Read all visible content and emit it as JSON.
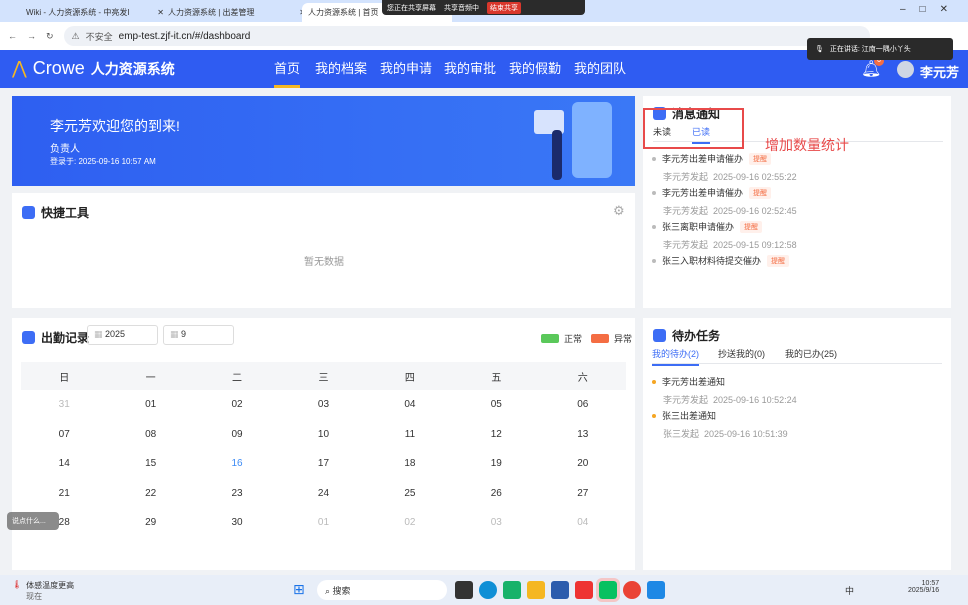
{
  "browser": {
    "tabs": [
      {
        "label": "Wiki - 人力资源系统 - 中亮发I"
      },
      {
        "label": "人力资源系统 | 出差管理"
      },
      {
        "label": "人力资源系统 | 首页"
      }
    ],
    "share_bar": {
      "sharing": "您正在共享屏幕",
      "audio": "共享音频中",
      "end": "结束共享"
    },
    "insecure": "不安全",
    "url": "emp-test.zjf-it.cn/#/dashboard",
    "speaking": "正在讲话: 江南一隅小丫头"
  },
  "header": {
    "brand": "Crowe",
    "system": "人力资源系统",
    "nav": [
      "首页",
      "我的档案",
      "我的申请",
      "我的审批",
      "我的假勤",
      "我的团队"
    ],
    "badge": "6",
    "user": "李元芳"
  },
  "banner": {
    "welcome": "李元芳欢迎您的到来!",
    "role": "负责人",
    "login": "登录于:  2025-09-16 10:57 AM"
  },
  "quick": {
    "title": "快捷工具",
    "empty": "暂无数据"
  },
  "attendance": {
    "title": "出勤记录",
    "year": "2025",
    "month": "9",
    "legend": [
      "正常",
      "异常"
    ],
    "weekdays": [
      "日",
      "一",
      "二",
      "三",
      "四",
      "五",
      "六"
    ],
    "weeks": [
      [
        "31",
        "01",
        "02",
        "03",
        "04",
        "05",
        "06"
      ],
      [
        "07",
        "08",
        "09",
        "10",
        "11",
        "12",
        "13"
      ],
      [
        "14",
        "15",
        "16",
        "17",
        "18",
        "19",
        "20"
      ],
      [
        "21",
        "22",
        "23",
        "24",
        "25",
        "26",
        "27"
      ],
      [
        "28",
        "29",
        "30",
        "01",
        "02",
        "03",
        "04"
      ]
    ]
  },
  "messages": {
    "title": "消息通知",
    "tabs": [
      "未读",
      "已读"
    ],
    "annotation": "增加数量统计",
    "items": [
      {
        "title": "李元芳出差申请催办",
        "tag": "提醒",
        "from": "李元芳发起",
        "time": "2025-09-16 02:55:22"
      },
      {
        "title": "李元芳出差申请催办",
        "tag": "提醒",
        "from": "李元芳发起",
        "time": "2025-09-16 02:52:45"
      },
      {
        "title": "张三离职申请催办",
        "tag": "提醒",
        "from": "李元芳发起",
        "time": "2025-09-15 09:12:58"
      },
      {
        "title": "张三入职材料待提交催办",
        "tag": "提醒",
        "from": "",
        "time": ""
      }
    ]
  },
  "todo": {
    "title": "待办任务",
    "tabs": [
      "我的待办(2)",
      "抄送我的(0)",
      "我的已办(25)"
    ],
    "items": [
      {
        "title": "李元芳出差通知",
        "from": "李元芳发起",
        "time": "2025-09-16 10:52:24"
      },
      {
        "title": "张三出差通知",
        "from": "张三发起",
        "time": "2025-09-16 10:51:39"
      }
    ]
  },
  "chat_hint": "说点什么...",
  "taskbar": {
    "weather": "体感温度更高",
    "weather_sub": "现在",
    "search": "搜索",
    "ime": "中",
    "time": "10:57",
    "date": "2025/9/16"
  }
}
